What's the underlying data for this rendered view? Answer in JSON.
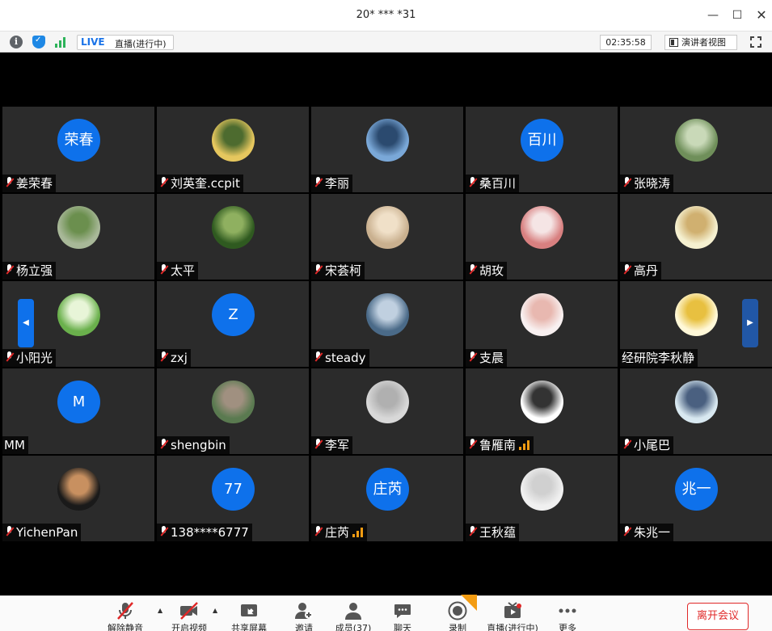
{
  "window": {
    "title": "20* *** *31"
  },
  "infobar": {
    "live_tag": "LIVE",
    "live_status": "直播(进行中)",
    "timer": "02:35:58",
    "speaker_view_label": "演讲者视图"
  },
  "participants": [
    {
      "name": "姜荣春",
      "avatar_text": "荣春",
      "muted": true
    },
    {
      "name": "刘英奎.ccpit",
      "avatar_text": "",
      "muted": true
    },
    {
      "name": "李丽",
      "avatar_text": "",
      "muted": true
    },
    {
      "name": "桑百川",
      "avatar_text": "百川",
      "muted": true
    },
    {
      "name": "张晓涛",
      "avatar_text": "",
      "muted": true
    },
    {
      "name": "杨立强",
      "avatar_text": "",
      "muted": true
    },
    {
      "name": "太平",
      "avatar_text": "",
      "muted": true
    },
    {
      "name": "宋荟柯",
      "avatar_text": "",
      "muted": true
    },
    {
      "name": "胡玫",
      "avatar_text": "",
      "muted": true
    },
    {
      "name": "高丹",
      "avatar_text": "",
      "muted": true
    },
    {
      "name": "小阳光",
      "avatar_text": "",
      "muted": true
    },
    {
      "name": "zxj",
      "avatar_text": "Z",
      "muted": true
    },
    {
      "name": "steady",
      "avatar_text": "",
      "muted": true
    },
    {
      "name": "支晨",
      "avatar_text": "",
      "muted": true
    },
    {
      "name": "经研院李秋静",
      "avatar_text": "",
      "muted": false
    },
    {
      "name": "MM",
      "avatar_text": "M",
      "muted": false
    },
    {
      "name": "shengbin",
      "avatar_text": "",
      "muted": true
    },
    {
      "name": "李军",
      "avatar_text": "",
      "muted": true
    },
    {
      "name": "鲁雁南",
      "avatar_text": "",
      "muted": true,
      "signal": true
    },
    {
      "name": "小尾巴",
      "avatar_text": "",
      "muted": true
    },
    {
      "name": "YichenPan",
      "avatar_text": "",
      "muted": true
    },
    {
      "name": "138****6777",
      "avatar_text": "77",
      "muted": true
    },
    {
      "name": "庄芮",
      "avatar_text": "庄芮",
      "muted": true,
      "signal": true
    },
    {
      "name": "王秋蕴",
      "avatar_text": "",
      "muted": true
    },
    {
      "name": "朱兆一",
      "avatar_text": "兆一",
      "muted": true
    }
  ],
  "toolbar": {
    "unmute": "解除静音",
    "start_video": "开启视频",
    "share_screen": "共享屏幕",
    "invite": "邀请",
    "participants": "成员(37)",
    "chat": "聊天",
    "record": "录制",
    "live": "直播(进行中)",
    "more": "更多",
    "leave": "离开会议"
  },
  "colors": {
    "accent": "#0e71eb",
    "leave": "#e02828",
    "tile_bg": "#2b2b2b"
  }
}
